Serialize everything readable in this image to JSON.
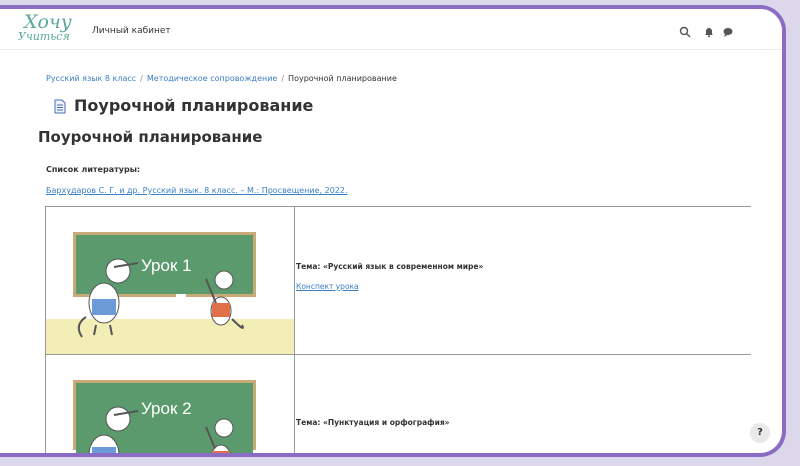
{
  "header": {
    "logo_line1": "Хочу",
    "logo_line2": "Учиться",
    "nav_link": "Личный кабинет"
  },
  "breadcrumb": {
    "item1": "Русский язык 8 класс",
    "item2": "Методическое сопровождение",
    "current": "Поурочной планирование",
    "separator": "/"
  },
  "page": {
    "title": "Поурочной планирование",
    "heading": "Поурочной планирование",
    "literature_label": "Список литературы:",
    "literature_ref": "Бархударов С. Г. и др. Русский язык. 8 класс. – М.: Просвещение, 2022."
  },
  "lessons": [
    {
      "board_text": "Урок 1",
      "topic": "Тема: «Русский язык в современном мире»",
      "summary": "Конспект урока"
    },
    {
      "board_text": "Урок 2",
      "topic": "Тема: «Пунктуация и орфография»"
    }
  ],
  "help": {
    "label": "?"
  },
  "icons": [
    "search-icon",
    "bell-icon",
    "chat-icon",
    "document-icon"
  ],
  "colors": {
    "frame": "#8a6cc4",
    "link": "#3a7fc1",
    "board": "#5b9a6c",
    "floor": "#f3eeb6",
    "logo": "#5aa89a"
  }
}
